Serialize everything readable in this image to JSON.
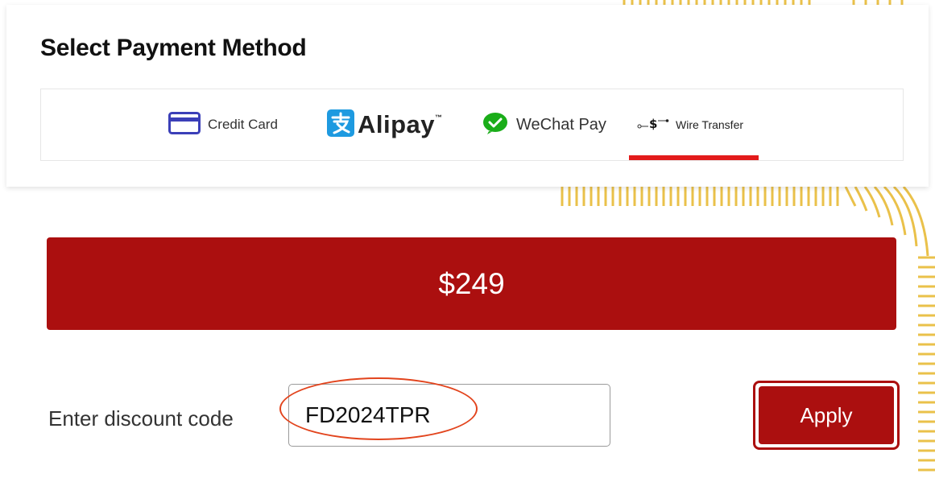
{
  "payment": {
    "title": "Select Payment Method",
    "methods": [
      {
        "label": "Credit Card",
        "icon": "credit-card-icon"
      },
      {
        "label": "Alipay",
        "icon": "alipay-icon",
        "trademark": "™"
      },
      {
        "label": "WeChat Pay",
        "icon": "wechat-icon"
      },
      {
        "label": "Wire Transfer",
        "icon": "wire-transfer-icon",
        "selected": true
      }
    ]
  },
  "price": {
    "amount": "$249"
  },
  "discount": {
    "label": "Enter discount code",
    "value": "FD2024TPR",
    "apply_label": "Apply"
  },
  "colors": {
    "primary": "#ab0f0f",
    "tab_underline": "#e31b1b",
    "highlight": "#e2441d",
    "credit_card_icon": "#3b3fb8",
    "alipay_icon": "#1e9ae0",
    "wechat_icon": "#1aad19"
  }
}
